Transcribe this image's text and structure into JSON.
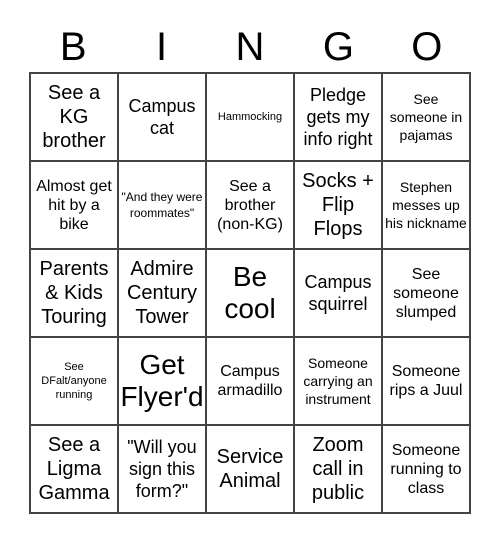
{
  "header": [
    "B",
    "I",
    "N",
    "G",
    "O"
  ],
  "cells": [
    {
      "text": "See a KG brother",
      "size": "s-l"
    },
    {
      "text": "Campus cat",
      "size": "s-m"
    },
    {
      "text": "Hammocking",
      "size": "s-xxs"
    },
    {
      "text": "Pledge gets my info right",
      "size": "s-m"
    },
    {
      "text": "See someone in pajamas",
      "size": "s-s"
    },
    {
      "text": "Almost get hit by a bike",
      "size": "s-sm"
    },
    {
      "text": "\"And they were roommates\"",
      "size": "s-xs"
    },
    {
      "text": "See a brother (non-KG)",
      "size": "s-sm"
    },
    {
      "text": "Socks + Flip Flops",
      "size": "s-l"
    },
    {
      "text": "Stephen messes up his nickname",
      "size": "s-s"
    },
    {
      "text": "Parents & Kids Touring",
      "size": "s-l"
    },
    {
      "text": "Admire Century Tower",
      "size": "s-l"
    },
    {
      "text": "Be cool",
      "size": "s-xl"
    },
    {
      "text": "Campus squirrel",
      "size": "s-m"
    },
    {
      "text": "See someone slumped",
      "size": "s-sm"
    },
    {
      "text": "See DFalt/anyone running",
      "size": "s-xxs"
    },
    {
      "text": "Get Flyer'd",
      "size": "s-xl"
    },
    {
      "text": "Campus armadillo",
      "size": "s-sm"
    },
    {
      "text": "Someone carrying an instrument",
      "size": "s-s"
    },
    {
      "text": "Someone rips a Juul",
      "size": "s-sm"
    },
    {
      "text": "See a Ligma Gamma",
      "size": "s-l"
    },
    {
      "text": "\"Will you sign this form?\"",
      "size": "s-m"
    },
    {
      "text": "Service Animal",
      "size": "s-l"
    },
    {
      "text": "Zoom call in public",
      "size": "s-l"
    },
    {
      "text": "Someone running to class",
      "size": "s-sm"
    }
  ]
}
